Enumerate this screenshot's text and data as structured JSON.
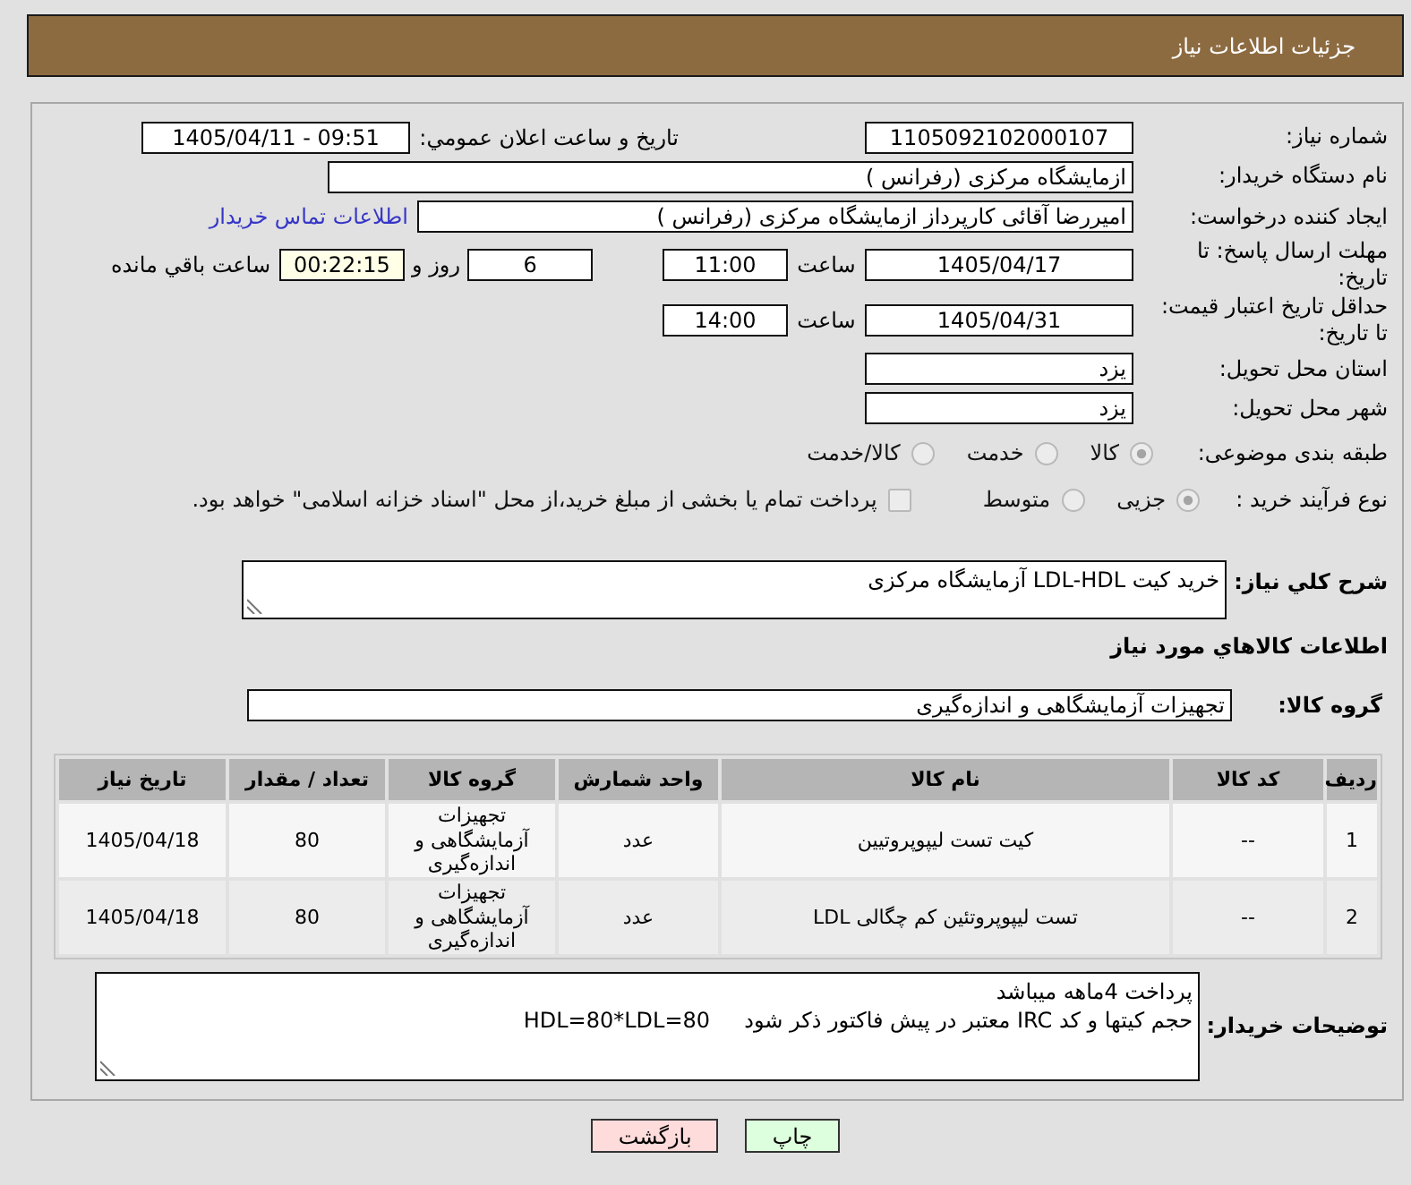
{
  "header": {
    "title": "جزئیات اطلاعات نیاز"
  },
  "need_number": {
    "label": "شماره نیاز:",
    "value": "1105092102000107"
  },
  "announcement": {
    "label": "تاریخ و ساعت اعلان عمومي:",
    "value": "1405/04/11 - 09:51"
  },
  "buyer_org": {
    "label": "نام دستگاه خریدار:",
    "value": "ازمایشگاه مرکزی (رفرانس )"
  },
  "requester": {
    "label": "ایجاد کننده درخواست:",
    "value": "امیررضا آقائی کارپرداز ازمایشگاه مرکزی (رفرانس )",
    "link": "اطلاعات تماس خریدار"
  },
  "reply_deadline": {
    "label": "مهلت ارسال پاسخ: تا تاریخ:",
    "date": "1405/04/17",
    "time_label": "ساعت",
    "time": "11:00",
    "days": "6",
    "days_label": "روز و",
    "remaining": "00:22:15",
    "remaining_label": "ساعت باقي مانده"
  },
  "price_validity": {
    "label": "حداقل تاریخ اعتبار قیمت: تا تاریخ:",
    "date": "1405/04/31",
    "time_label": "ساعت",
    "time": "14:00"
  },
  "delivery_province": {
    "label": "استان محل تحویل:",
    "value": "یزد"
  },
  "delivery_city": {
    "label": "شهر محل تحویل:",
    "value": "یزد"
  },
  "category": {
    "label": "طبقه بندی موضوعی:",
    "options": [
      {
        "label": "کالا",
        "selected": true
      },
      {
        "label": "خدمت",
        "selected": false
      },
      {
        "label": "کالا/خدمت",
        "selected": false
      }
    ]
  },
  "purchase_process": {
    "label": "نوع فرآیند خرید :",
    "options": [
      {
        "label": "جزیی",
        "selected": true
      },
      {
        "label": "متوسط",
        "selected": false
      }
    ],
    "treasury": {
      "label": "پرداخت تمام یا بخشی از مبلغ خرید،از محل \"اسناد خزانه اسلامی\" خواهد بود.",
      "checked": false
    }
  },
  "summary": {
    "label": "شرح كلي نياز:",
    "value": "خرید کیت LDL-HDL آزمایشگاه مرکزی"
  },
  "goods_heading": "اطلاعات كالاهاي مورد نياز",
  "goods_group": {
    "label": "گروه کالا:",
    "value": "تجهیزات آزمایشگاهی و اندازه‌گیری"
  },
  "table": {
    "columns": [
      "ردیف",
      "کد کالا",
      "نام کالا",
      "واحد شمارش",
      "گروه کالا",
      "تعداد / مقدار",
      "تاریخ نیاز"
    ],
    "rows": [
      [
        "1",
        "--",
        "کیت تست لیپوپروتیین",
        "عدد",
        "تجهیزات آزمایشگاهی و اندازه‌گیری",
        "80",
        "1405/04/18"
      ],
      [
        "2",
        "--",
        "تست لیپوپروتئین کم چگالی LDL",
        "عدد",
        "تجهیزات آزمایشگاهی و اندازه‌گیری",
        "80",
        "1405/04/18"
      ]
    ]
  },
  "buyer_notes": {
    "label": "توضیحات خریدار:",
    "lines": [
      "پرداخت 4ماهه میباشد",
      "حجم کیتها و کد IRC معتبر در پیش فاکتور ذکر شود     HDL=80*LDL=80"
    ]
  },
  "buttons": [
    {
      "label": "چاپ",
      "kind": "print"
    },
    {
      "label": "بازگشت",
      "kind": "back"
    }
  ]
}
